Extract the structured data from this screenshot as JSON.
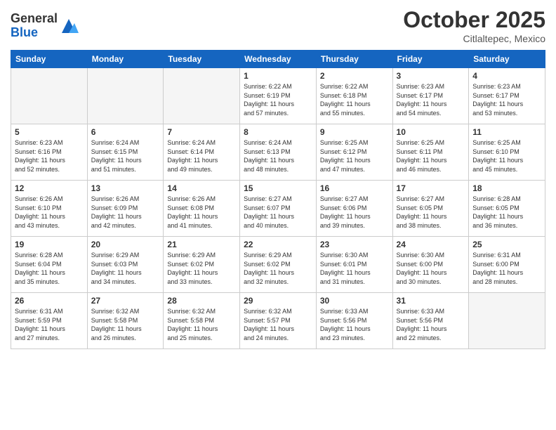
{
  "logo": {
    "general": "General",
    "blue": "Blue"
  },
  "header": {
    "month": "October 2025",
    "location": "Citlaltepec, Mexico"
  },
  "weekdays": [
    "Sunday",
    "Monday",
    "Tuesday",
    "Wednesday",
    "Thursday",
    "Friday",
    "Saturday"
  ],
  "weeks": [
    [
      {
        "day": "",
        "info": ""
      },
      {
        "day": "",
        "info": ""
      },
      {
        "day": "",
        "info": ""
      },
      {
        "day": "1",
        "info": "Sunrise: 6:22 AM\nSunset: 6:19 PM\nDaylight: 11 hours\nand 57 minutes."
      },
      {
        "day": "2",
        "info": "Sunrise: 6:22 AM\nSunset: 6:18 PM\nDaylight: 11 hours\nand 55 minutes."
      },
      {
        "day": "3",
        "info": "Sunrise: 6:23 AM\nSunset: 6:17 PM\nDaylight: 11 hours\nand 54 minutes."
      },
      {
        "day": "4",
        "info": "Sunrise: 6:23 AM\nSunset: 6:17 PM\nDaylight: 11 hours\nand 53 minutes."
      }
    ],
    [
      {
        "day": "5",
        "info": "Sunrise: 6:23 AM\nSunset: 6:16 PM\nDaylight: 11 hours\nand 52 minutes."
      },
      {
        "day": "6",
        "info": "Sunrise: 6:24 AM\nSunset: 6:15 PM\nDaylight: 11 hours\nand 51 minutes."
      },
      {
        "day": "7",
        "info": "Sunrise: 6:24 AM\nSunset: 6:14 PM\nDaylight: 11 hours\nand 49 minutes."
      },
      {
        "day": "8",
        "info": "Sunrise: 6:24 AM\nSunset: 6:13 PM\nDaylight: 11 hours\nand 48 minutes."
      },
      {
        "day": "9",
        "info": "Sunrise: 6:25 AM\nSunset: 6:12 PM\nDaylight: 11 hours\nand 47 minutes."
      },
      {
        "day": "10",
        "info": "Sunrise: 6:25 AM\nSunset: 6:11 PM\nDaylight: 11 hours\nand 46 minutes."
      },
      {
        "day": "11",
        "info": "Sunrise: 6:25 AM\nSunset: 6:10 PM\nDaylight: 11 hours\nand 45 minutes."
      }
    ],
    [
      {
        "day": "12",
        "info": "Sunrise: 6:26 AM\nSunset: 6:10 PM\nDaylight: 11 hours\nand 43 minutes."
      },
      {
        "day": "13",
        "info": "Sunrise: 6:26 AM\nSunset: 6:09 PM\nDaylight: 11 hours\nand 42 minutes."
      },
      {
        "day": "14",
        "info": "Sunrise: 6:26 AM\nSunset: 6:08 PM\nDaylight: 11 hours\nand 41 minutes."
      },
      {
        "day": "15",
        "info": "Sunrise: 6:27 AM\nSunset: 6:07 PM\nDaylight: 11 hours\nand 40 minutes."
      },
      {
        "day": "16",
        "info": "Sunrise: 6:27 AM\nSunset: 6:06 PM\nDaylight: 11 hours\nand 39 minutes."
      },
      {
        "day": "17",
        "info": "Sunrise: 6:27 AM\nSunset: 6:05 PM\nDaylight: 11 hours\nand 38 minutes."
      },
      {
        "day": "18",
        "info": "Sunrise: 6:28 AM\nSunset: 6:05 PM\nDaylight: 11 hours\nand 36 minutes."
      }
    ],
    [
      {
        "day": "19",
        "info": "Sunrise: 6:28 AM\nSunset: 6:04 PM\nDaylight: 11 hours\nand 35 minutes."
      },
      {
        "day": "20",
        "info": "Sunrise: 6:29 AM\nSunset: 6:03 PM\nDaylight: 11 hours\nand 34 minutes."
      },
      {
        "day": "21",
        "info": "Sunrise: 6:29 AM\nSunset: 6:02 PM\nDaylight: 11 hours\nand 33 minutes."
      },
      {
        "day": "22",
        "info": "Sunrise: 6:29 AM\nSunset: 6:02 PM\nDaylight: 11 hours\nand 32 minutes."
      },
      {
        "day": "23",
        "info": "Sunrise: 6:30 AM\nSunset: 6:01 PM\nDaylight: 11 hours\nand 31 minutes."
      },
      {
        "day": "24",
        "info": "Sunrise: 6:30 AM\nSunset: 6:00 PM\nDaylight: 11 hours\nand 30 minutes."
      },
      {
        "day": "25",
        "info": "Sunrise: 6:31 AM\nSunset: 6:00 PM\nDaylight: 11 hours\nand 28 minutes."
      }
    ],
    [
      {
        "day": "26",
        "info": "Sunrise: 6:31 AM\nSunset: 5:59 PM\nDaylight: 11 hours\nand 27 minutes."
      },
      {
        "day": "27",
        "info": "Sunrise: 6:32 AM\nSunset: 5:58 PM\nDaylight: 11 hours\nand 26 minutes."
      },
      {
        "day": "28",
        "info": "Sunrise: 6:32 AM\nSunset: 5:58 PM\nDaylight: 11 hours\nand 25 minutes."
      },
      {
        "day": "29",
        "info": "Sunrise: 6:32 AM\nSunset: 5:57 PM\nDaylight: 11 hours\nand 24 minutes."
      },
      {
        "day": "30",
        "info": "Sunrise: 6:33 AM\nSunset: 5:56 PM\nDaylight: 11 hours\nand 23 minutes."
      },
      {
        "day": "31",
        "info": "Sunrise: 6:33 AM\nSunset: 5:56 PM\nDaylight: 11 hours\nand 22 minutes."
      },
      {
        "day": "",
        "info": ""
      }
    ]
  ]
}
